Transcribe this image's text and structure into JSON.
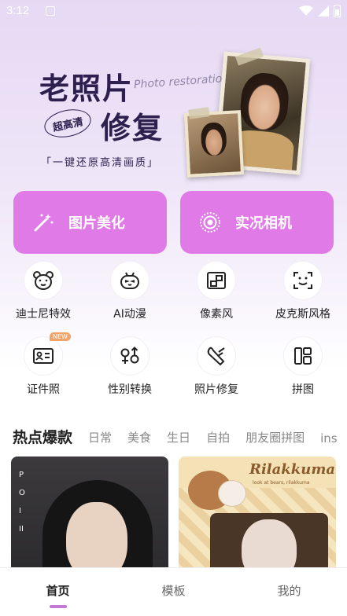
{
  "status_bar": {
    "time": "3:12"
  },
  "banner": {
    "title_line1": "老照片",
    "title_line2": "修复",
    "subtitle": "Photo restoration",
    "badge": "超高清",
    "slogan": "「一键还原高清画质」"
  },
  "main_buttons": [
    {
      "label": "图片美化",
      "icon": "magic-wand-icon"
    },
    {
      "label": "实况相机",
      "icon": "live-camera-icon"
    }
  ],
  "features": [
    {
      "label": "迪士尼特效",
      "icon": "bear-face-icon"
    },
    {
      "label": "AI动漫",
      "icon": "robot-face-icon"
    },
    {
      "label": "像素风",
      "icon": "pixel-frame-icon"
    },
    {
      "label": "皮克斯风格",
      "icon": "face-scan-icon"
    },
    {
      "label": "证件照",
      "icon": "id-card-icon",
      "badge": "NEW"
    },
    {
      "label": "性别转换",
      "icon": "gender-icon"
    },
    {
      "label": "照片修复",
      "icon": "wrench-icon"
    },
    {
      "label": "拼图",
      "icon": "collage-icon"
    }
  ],
  "category_tabs": [
    "热点爆款",
    "日常",
    "美食",
    "生日",
    "自拍",
    "朋友圈拼图",
    "ins"
  ],
  "cards": [
    {
      "side_text": [
        "P",
        "O",
        "I",
        "II"
      ]
    },
    {
      "brand": "Rilakkuma",
      "brand_sub": "look at bears, rilakkuma"
    }
  ],
  "bottom_nav": [
    "首页",
    "模板",
    "我的"
  ],
  "colors": {
    "accent": "#e07ae6",
    "indicator": "#c478d8",
    "title": "#2d1f4e"
  }
}
